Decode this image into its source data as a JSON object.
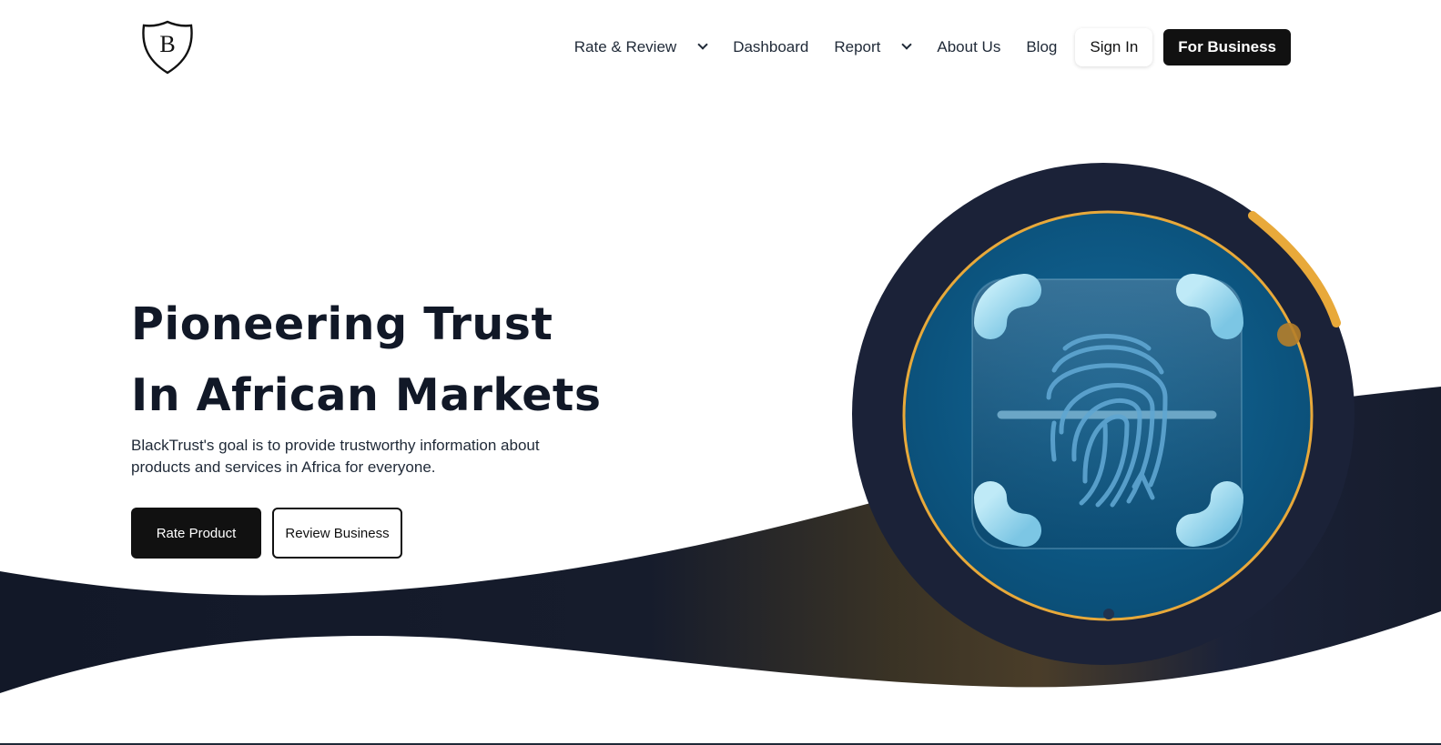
{
  "brand": {
    "logo_letter": "B"
  },
  "nav": {
    "items": [
      {
        "label": "Rate & Review",
        "has_dropdown": true
      },
      {
        "label": "Dashboard",
        "has_dropdown": false
      },
      {
        "label": "Report",
        "has_dropdown": true
      },
      {
        "label": "About Us",
        "has_dropdown": false
      },
      {
        "label": "Blog",
        "has_dropdown": false
      }
    ],
    "sign_in": "Sign In",
    "for_business": "For Business"
  },
  "hero": {
    "title_line1": "Pioneering Trust",
    "title_line2": "In African Markets",
    "subtitle": "BlackTrust's goal is to provide trustworthy information about products and services in Africa for everyone.",
    "primary_cta": "Rate Product",
    "secondary_cta": "Review Business"
  },
  "illustration": {
    "icon": "fingerprint-icon"
  },
  "colors": {
    "dark_navy": "#1b2238",
    "accent_gold": "#e8a93a",
    "scanner_blue": "#0c5a87",
    "button_black": "#111111"
  }
}
